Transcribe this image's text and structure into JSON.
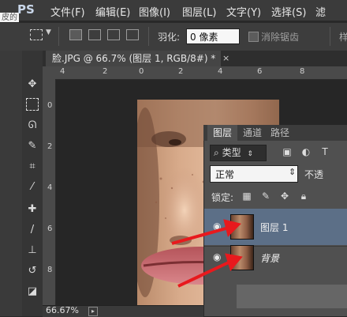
{
  "app": {
    "logo": "PS",
    "page_fragment": "皮的"
  },
  "menu": [
    {
      "label": "文件(F)"
    },
    {
      "label": "编辑(E)"
    },
    {
      "label": "图像(I)"
    },
    {
      "label": "图层(L)"
    },
    {
      "label": "文字(Y)"
    },
    {
      "label": "选择(S)"
    },
    {
      "label": "滤"
    }
  ],
  "options": {
    "feather_label": "羽化:",
    "feather_value": "0 像素",
    "antialias_label": "消除锯齿",
    "antialias_checked": false,
    "right_fragment": "样"
  },
  "document": {
    "tab_title": "脸.JPG @ 66.7% (图层 1, RGB/8#) *",
    "close_glyph": "×",
    "zoom": "66.67%"
  },
  "ruler": {
    "top_ticks": [
      "4",
      "2",
      "0",
      "2",
      "4",
      "6",
      "8"
    ],
    "left_ticks": [
      "0",
      "2",
      "4",
      "6",
      "8"
    ]
  },
  "layers_panel": {
    "tabs": [
      "图层",
      "通道",
      "路径"
    ],
    "filter_kind": "类型",
    "blend_mode": "正常",
    "opacity_label": "不透",
    "lock_label": "锁定:",
    "layers": [
      {
        "name": "图层 1",
        "visible": true,
        "selected": true
      },
      {
        "name": "背景",
        "visible": true,
        "selected": false
      }
    ]
  },
  "colors": {
    "selected_row": "#5c6f87",
    "annotation_arrow": "#e8191d"
  }
}
